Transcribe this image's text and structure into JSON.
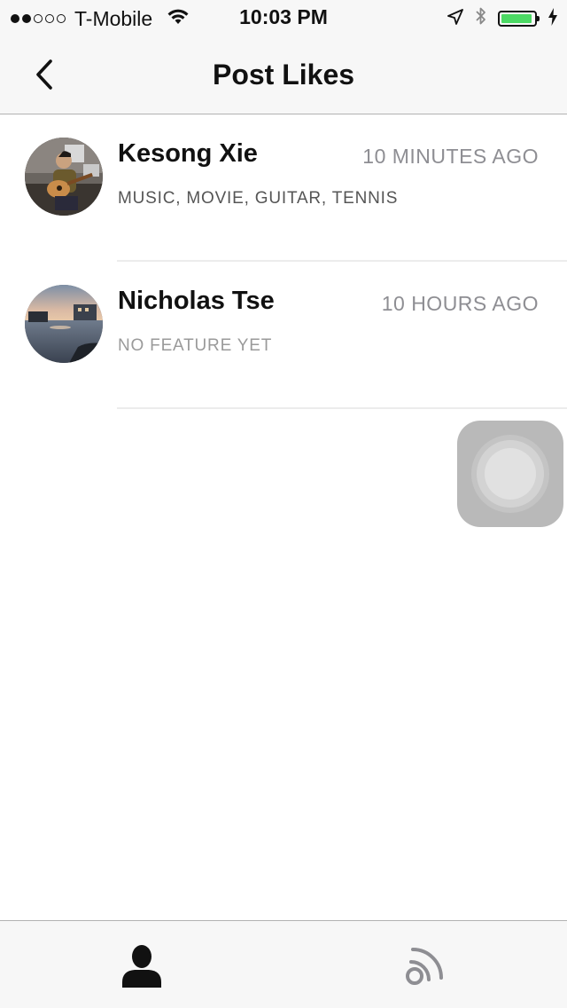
{
  "status_bar": {
    "carrier": "T-Mobile",
    "time": "10:03 PM",
    "signal_bars_filled": 2,
    "signal_bars_total": 5,
    "battery_level": 0.95,
    "battery_color": "#4cd964"
  },
  "nav": {
    "title": "Post Likes",
    "back_icon": "chevron-left-icon"
  },
  "likes": [
    {
      "name": "Kesong Xie",
      "time": "10 MINUTES AGO",
      "tags": "MUSIC, MOVIE, GUITAR, TENNIS",
      "avatar_icon": "person-with-guitar-photo"
    },
    {
      "name": "Nicholas Tse",
      "time": "10 HOURS AGO",
      "tags": "NO FEATURE YET",
      "avatar_icon": "waterfront-sunset-photo"
    }
  ],
  "tab_bar": {
    "tabs": [
      {
        "icon": "person-icon",
        "active": true
      },
      {
        "icon": "feed-icon",
        "active": false
      }
    ],
    "active_color": "#111111",
    "inactive_color": "#8e8e93"
  }
}
